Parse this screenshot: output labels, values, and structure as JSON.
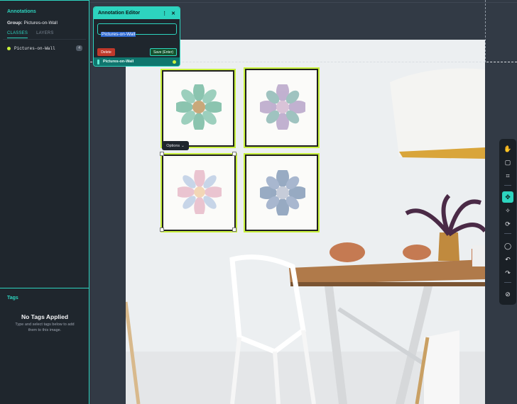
{
  "sidebar": {
    "annotations_title": "Annotations",
    "group_label": "Group:",
    "group_value": "Pictures-on-Wall",
    "tabs": [
      {
        "label": "CLASSES",
        "active": true
      },
      {
        "label": "LAYERS",
        "active": false
      }
    ],
    "classes": [
      {
        "label": "Pictures-on-Wall",
        "count": "4",
        "color": "#c8f13b"
      }
    ],
    "tags_title": "Tags",
    "no_tags_title": "No Tags Applied",
    "no_tags_sub": "Type and select tags below to add them to this image."
  },
  "editor": {
    "title": "Annotation Editor",
    "menu_icon": "kebab-icon",
    "close_icon": "close-icon",
    "input_value": "Pictures-on-Wall",
    "delete_label": "Delete",
    "save_label": "Save (Enter)",
    "footer_label": "Pictures-on-Wall",
    "accent": "#2dd4bf"
  },
  "canvas": {
    "options_label": "Options",
    "annotation_color": "#c8f13b"
  },
  "toolbar": {
    "tools": [
      {
        "name": "hand-icon",
        "glyph": "✋",
        "active": false
      },
      {
        "name": "bounding-box-icon",
        "glyph": "▢",
        "active": false
      },
      {
        "name": "polygon-icon",
        "glyph": "⌗",
        "active": false
      },
      {
        "name": "smart-polygon-icon",
        "glyph": "✥",
        "active": true
      },
      {
        "name": "magic-wand-icon",
        "glyph": "✧",
        "active": false
      },
      {
        "name": "repeat-icon",
        "glyph": "⟳",
        "active": false
      },
      {
        "name": "comment-icon",
        "glyph": "◯",
        "active": false
      },
      {
        "name": "undo-icon",
        "glyph": "↶",
        "active": false
      },
      {
        "name": "redo-icon",
        "glyph": "↷",
        "active": false
      },
      {
        "name": "hide-icon",
        "glyph": "⊘",
        "active": false
      }
    ]
  }
}
